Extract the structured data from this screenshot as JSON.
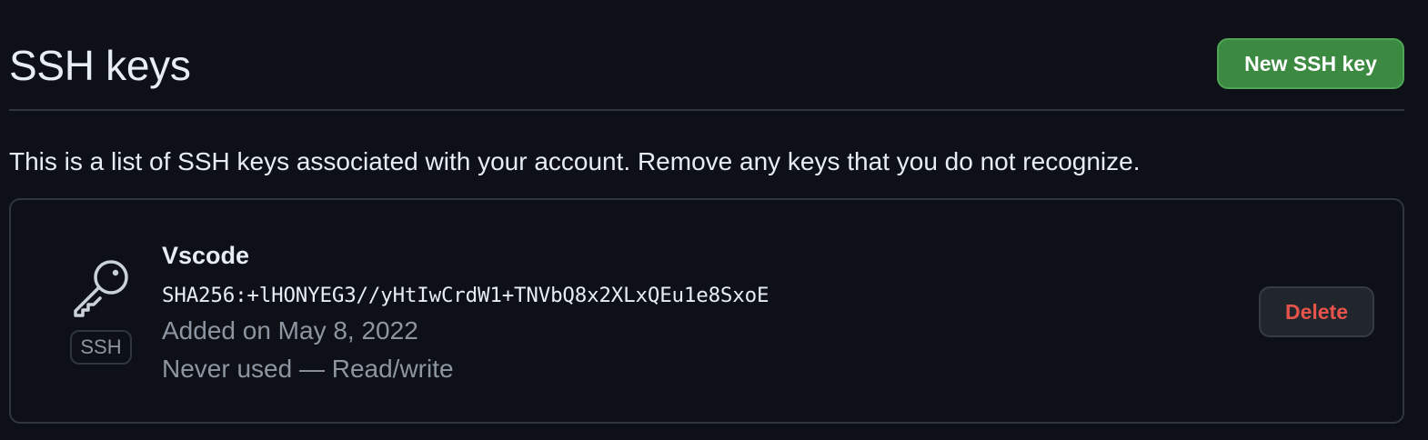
{
  "header": {
    "title": "SSH keys",
    "new_key_label": "New SSH key"
  },
  "intro": "This is a list of SSH keys associated with your account. Remove any keys that you do not recognize.",
  "keys": [
    {
      "title": "Vscode",
      "fingerprint": "SHA256:+lHONYEG3//yHtIwCrdW1+TNVbQ8x2XLxQEu1e8SxoE",
      "added": "Added on May 8, 2022",
      "usage": "Never used — Read/write",
      "badge": "SSH",
      "icon": "key-icon",
      "delete_label": "Delete"
    }
  ],
  "colors": {
    "background": "#0d1117",
    "primary_button": "#3c8a41",
    "danger_text": "#e5534b",
    "muted_text": "#8d96a0",
    "border": "#30363d"
  }
}
